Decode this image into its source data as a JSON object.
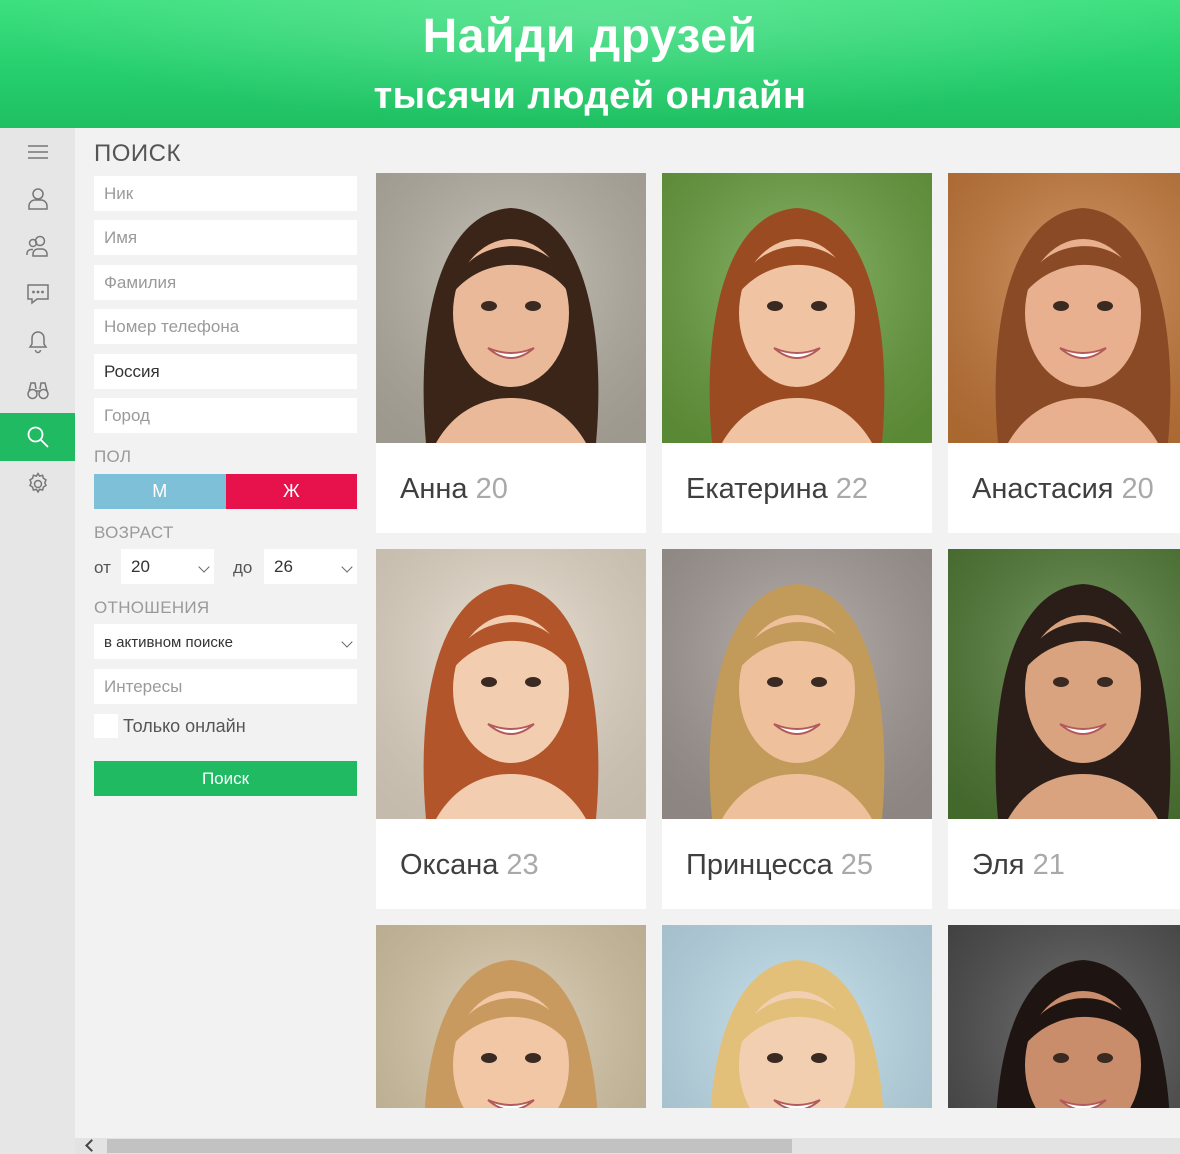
{
  "banner": {
    "title": "Найди друзей",
    "subtitle": "тысячи людей онлайн"
  },
  "colors": {
    "accent_green": "#1fba62",
    "male_blue": "#7ec0d7",
    "female_red": "#e7124b"
  },
  "rail": [
    {
      "icon": "menu-icon",
      "active": false
    },
    {
      "icon": "profile-icon",
      "active": false
    },
    {
      "icon": "friends-icon",
      "active": false
    },
    {
      "icon": "messages-icon",
      "active": false
    },
    {
      "icon": "bell-icon",
      "active": false
    },
    {
      "icon": "binoculars-icon",
      "active": false
    },
    {
      "icon": "search-icon",
      "active": true
    },
    {
      "icon": "gear-icon",
      "active": false
    }
  ],
  "search": {
    "title": "ПОИСК",
    "nick_placeholder": "Ник",
    "name_placeholder": "Имя",
    "surname_placeholder": "Фамилия",
    "phone_placeholder": "Номер телефона",
    "country_value": "Россия",
    "city_placeholder": "Город",
    "gender_label": "ПОЛ",
    "gender_male": "М",
    "gender_female": "Ж",
    "age_label": "ВОЗРАСТ",
    "age_from_label": "от",
    "age_from_value": "20",
    "age_to_label": "до",
    "age_to_value": "26",
    "relations_label": "ОТНОШЕНИЯ",
    "relations_value": "в активном поиске",
    "interests_placeholder": "Интересы",
    "online_only_label": "Только онлайн",
    "online_only_checked": false,
    "submit_label": "Поиск"
  },
  "cards": [
    {
      "name": "Анна",
      "age": "20",
      "hair": "#3b2418",
      "bg": "#b9b4a7"
    },
    {
      "name": "Екатерина",
      "age": "22",
      "hair": "#9b4b22",
      "bg": "#6aa13f"
    },
    {
      "name": "Анастасия",
      "age": "20",
      "hair": "#8a4a25",
      "bg": "#c87a3a"
    },
    {
      "name": "Оксана",
      "age": "23",
      "hair": "#b2552a",
      "bg": "#e8dccb"
    },
    {
      "name": "Принцесса",
      "age": "25",
      "hair": "#c29a5a",
      "bg": "#a59c98"
    },
    {
      "name": "Эля",
      "age": "21",
      "hair": "#2b1d17",
      "bg": "#4f7a34"
    },
    {
      "name": "",
      "age": "",
      "hair": "#c99a5f",
      "bg": "#d9c9a8"
    },
    {
      "name": "",
      "age": "",
      "hair": "#e2c07a",
      "bg": "#bfe0ee"
    },
    {
      "name": "",
      "age": "",
      "hair": "#1e1512",
      "bg": "#4a4a4a"
    }
  ]
}
